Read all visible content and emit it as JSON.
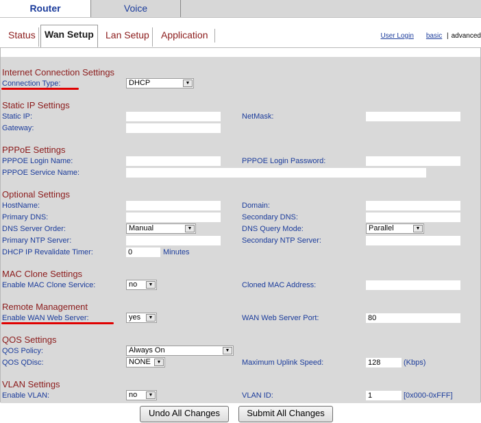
{
  "top_tabs": {
    "router": "Router",
    "voice": "Voice"
  },
  "sub_tabs": [
    "Status",
    "Wan Setup",
    "Lan Setup",
    "Application"
  ],
  "right_links": {
    "user_login": "User Login",
    "basic": "basic",
    "separator": "|",
    "advanced": "advanced"
  },
  "sections": {
    "internet": {
      "title": "Internet Connection Settings",
      "connection_type_label": "Connection Type:",
      "connection_type_value": "DHCP"
    },
    "static_ip": {
      "title": "Static IP Settings",
      "static_ip_label": "Static IP:",
      "netmask_label": "NetMask:",
      "gateway_label": "Gateway:"
    },
    "pppoe": {
      "title": "PPPoE Settings",
      "login_name_label": "PPPOE Login Name:",
      "login_password_label": "PPPOE Login Password:",
      "service_name_label": "PPPOE Service Name:"
    },
    "optional": {
      "title": "Optional Settings",
      "hostname_label": "HostName:",
      "domain_label": "Domain:",
      "primary_dns_label": "Primary DNS:",
      "secondary_dns_label": "Secondary DNS:",
      "dns_order_label": "DNS Server Order:",
      "dns_order_value": "Manual",
      "dns_query_label": "DNS Query Mode:",
      "dns_query_value": "Parallel",
      "primary_ntp_label": "Primary NTP Server:",
      "secondary_ntp_label": "Secondary NTP Server:",
      "dhcp_timer_label": "DHCP IP Revalidate Timer:",
      "dhcp_timer_value": "0",
      "dhcp_timer_unit": "Minutes"
    },
    "mac_clone": {
      "title": "MAC Clone Settings",
      "enable_label": "Enable MAC Clone Service:",
      "enable_value": "no",
      "cloned_mac_label": "Cloned MAC Address:"
    },
    "remote": {
      "title": "Remote Management",
      "enable_label": "Enable WAN Web Server:",
      "enable_value": "yes",
      "port_label": "WAN Web Server Port:",
      "port_value": "80"
    },
    "qos": {
      "title": "QOS Settings",
      "policy_label": "QOS Policy:",
      "policy_value": "Always On",
      "qdisc_label": "QOS QDisc:",
      "qdisc_value": "NONE",
      "uplink_label": "Maximum Uplink Speed:",
      "uplink_value": "128",
      "uplink_unit": "(Kbps)"
    },
    "vlan": {
      "title": "VLAN Settings",
      "enable_label": "Enable VLAN:",
      "enable_value": "no",
      "id_label": "VLAN ID:",
      "id_value": "1",
      "id_range": "[0x000-0xFFF]"
    }
  },
  "buttons": {
    "undo": "Undo All Changes",
    "submit": "Submit All Changes"
  },
  "colors": {
    "section_title": "#8b1a1a",
    "label": "#1a3b9b",
    "panel_bg": "#d9d9d9",
    "annotation": "#e00000"
  }
}
